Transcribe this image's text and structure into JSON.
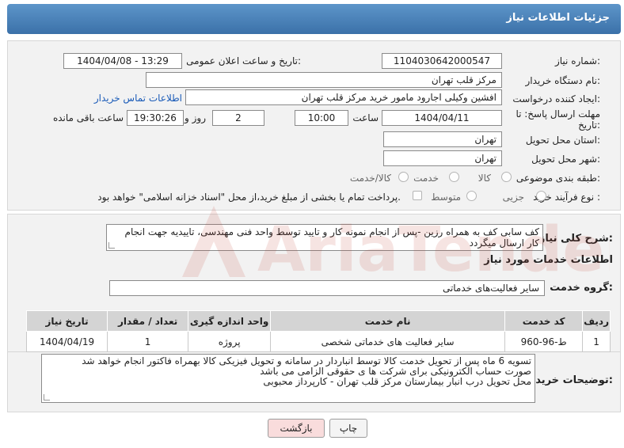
{
  "header": {
    "title": "جزئیات اطلاعات نیاز"
  },
  "form": {
    "need_number_label": "شماره نیاز:",
    "need_number": "1104030642000547",
    "announce_label": "تاریخ و ساعت اعلان عمومی:",
    "announce_value": "1404/04/08 - 13:29",
    "buyer_org_label": "نام دستگاه خریدار:",
    "buyer_org": "مرکز قلب تهران",
    "creator_label": "ایجاد کننده درخواست:",
    "creator": "افشین وکیلی اجارود مامور خرید مرکز قلب تهران",
    "contact_link": "اطلاعات تماس خریدار",
    "deadline_label_1": "مهلت ارسال پاسخ: تا",
    "deadline_label_2": "تاریخ:",
    "deadline_date": "1404/04/11",
    "time_label": "ساعت",
    "deadline_time": "10:00",
    "days_value": "2",
    "days_label": "روز و",
    "remaining_time": "19:30:26",
    "remaining_label": "ساعت باقی مانده",
    "province_label": "استان محل تحویل:",
    "province": "تهران",
    "city_label": "شهر محل تحویل:",
    "city": "تهران",
    "category_label": "طبقه بندی موضوعی:",
    "category_options": [
      "کالا",
      "خدمت",
      "کالا/خدمت"
    ],
    "process_label": "نوع فرآیند خرید :",
    "process_options": [
      "جزیی",
      "متوسط"
    ],
    "payment_note": "پرداخت تمام یا بخشی از مبلغ خرید،از محل \"اسناد خزانه اسلامی\" خواهد بود."
  },
  "description": {
    "label": "شرح کلی نیاز:",
    "text": "کف سابی کف به همراه رزین -پس از انجام نمونه کار و تایید توسط واحد فنی مهندسی، تاییدیه جهت انجام کار ارسال میگردد"
  },
  "services": {
    "section_title": "اطلاعات خدمات مورد نیاز",
    "group_label": "گروه خدمت:",
    "group_value": "سایر فعالیت‌های خدماتی",
    "columns": [
      "ردیف",
      "کد خدمت",
      "نام خدمت",
      "واحد اندازه گیری",
      "تعداد / مقدار",
      "تاریخ نیاز"
    ],
    "rows": [
      [
        "1",
        "ط-96-960",
        "سایر فعالیت های خدماتی شخصی",
        "پروژه",
        "1",
        "1404/04/19"
      ]
    ]
  },
  "buyer_notes": {
    "label": "توضیحات خریدار:",
    "lines": [
      "تسویه 6 ماه پس از تحویل خدمت کالا توسط انباردار در سامانه و تحویل فیزیکی کالا بهمراه فاکتور انجام خواهد شد",
      "صورت حساب الکترونیکی برای شرکت ها ی حقوقی الزامی می باشد",
      "محل تحویل درب انبار بیمارستان مرکز قلب تهران - کارپرداز محبوبی"
    ]
  },
  "buttons": {
    "print": "چاپ",
    "back": "بازگشت"
  },
  "watermark": {
    "text": "AriaTender.neT"
  }
}
